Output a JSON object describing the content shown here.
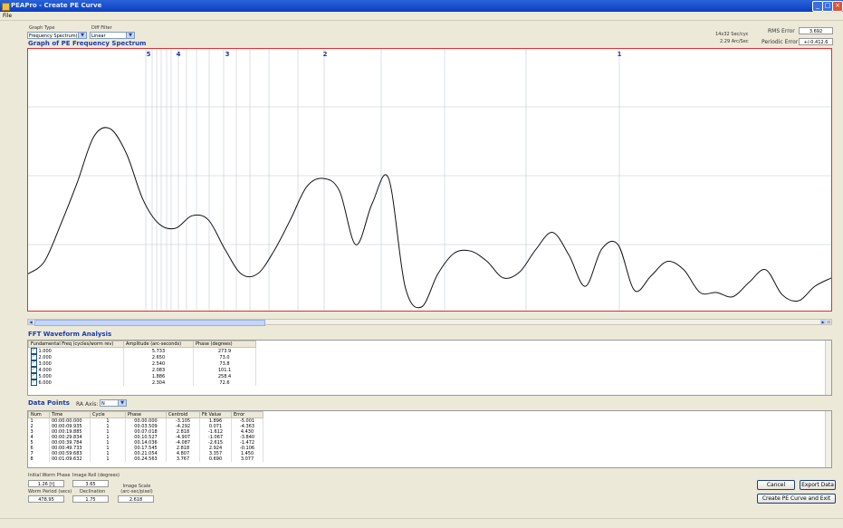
{
  "window": {
    "title": "PEAPro - Create PE Curve",
    "min": "_",
    "max": "□",
    "close": "×"
  },
  "menu": {
    "file": "File"
  },
  "graph_type": {
    "label": "Graph Type",
    "value": "Frequency Spectrum(sec"
  },
  "diff_filter": {
    "label": "Diff Filter",
    "value": "Linear"
  },
  "cycle_info": {
    "line1": "14x32 Sec/cyc",
    "line2": "2.29 Arc/Sec"
  },
  "rms_error": {
    "label": "RMS Error",
    "value": "3.692"
  },
  "periodic_error": {
    "label": "Periodic Error",
    "value": "+/-0.412.6"
  },
  "graph_title": "Graph of PE Frequency Spectrum",
  "chart_data": {
    "type": "line",
    "title": "Graph of PE Frequency Spectrum",
    "marker_labels": [
      "5",
      "4",
      "3",
      "2",
      "1"
    ],
    "curve_y": [
      0.16,
      0.22,
      0.4,
      0.6,
      0.82,
      0.86,
      0.74,
      0.52,
      0.4,
      0.38,
      0.44,
      0.42,
      0.28,
      0.16,
      0.16,
      0.27,
      0.42,
      0.58,
      0.62,
      0.56,
      0.3,
      0.5,
      0.62,
      0.1,
      0.0,
      0.16,
      0.26,
      0.27,
      0.22,
      0.14,
      0.17,
      0.28,
      0.36,
      0.25,
      0.1,
      0.28,
      0.3,
      0.08,
      0.15,
      0.22,
      0.18,
      0.07,
      0.07,
      0.05,
      0.12,
      0.18,
      0.06,
      0.03,
      0.1,
      0.14
    ]
  },
  "fft": {
    "title": "FFT Waveform Analysis",
    "columns": [
      "Fundamental Freq (cycles/worm rev)",
      "Amplitude (arc-seconds)",
      "Phase (degrees)"
    ],
    "rows": [
      {
        "checked": "✓",
        "freq": "1.000",
        "amp": "5.733",
        "phase": "273.9"
      },
      {
        "checked": "✓",
        "freq": "2.000",
        "amp": "2.650",
        "phase": "73.0"
      },
      {
        "checked": "✓",
        "freq": "3.000",
        "amp": "2.540",
        "phase": "73.8"
      },
      {
        "checked": "✓",
        "freq": "4.000",
        "amp": "2.083",
        "phase": "101.1"
      },
      {
        "checked": "✓",
        "freq": "5.000",
        "amp": "1.886",
        "phase": "258.4"
      },
      {
        "checked": "✓",
        "freq": "6.000",
        "amp": "2.304",
        "phase": "72.6"
      }
    ]
  },
  "data_points": {
    "title": "Data Points",
    "ra_axis_label": "RA Axis:",
    "ra_axis_value": "N",
    "columns": [
      "Num",
      "Time",
      "Cycle",
      "Phase",
      "Centroid",
      "Fit Value",
      "Error"
    ],
    "rows": [
      [
        "1",
        "00:00:00.000",
        "1",
        "00.00.000",
        "-3.105",
        "1.896",
        "-5.001"
      ],
      [
        "2",
        "00:00:09.935",
        "1",
        "00.03.509",
        "-4.292",
        "0.071",
        "-4.363"
      ],
      [
        "3",
        "00:00:19.885",
        "1",
        "00.07.018",
        "2.818",
        "-1.612",
        "4.430"
      ],
      [
        "4",
        "00:00:29.834",
        "1",
        "00.10.527",
        "-4.907",
        "-1.067",
        "-3.840"
      ],
      [
        "5",
        "00:00:39.784",
        "1",
        "00.14.036",
        "-4.087",
        "-2.615",
        "-1.472"
      ],
      [
        "6",
        "00:00:49.733",
        "1",
        "00.17.545",
        "2.818",
        "2.924",
        "-0.106"
      ],
      [
        "7",
        "00:00:59.683",
        "1",
        "00.21.054",
        "4.807",
        "3.357",
        "1.450"
      ],
      [
        "8",
        "00:01:09.632",
        "1",
        "00.24.563",
        "3.767",
        "0.690",
        "3.077"
      ]
    ]
  },
  "stats": {
    "initial_worm_phase": {
      "label": "Initial Worm Phase",
      "value": "1.26 [t]"
    },
    "image_roll": {
      "label": "Image Roll (degrees)",
      "value": "3.65"
    },
    "worm_period": {
      "label": "Worm Period (secs)",
      "value": "478.95"
    },
    "declination": {
      "label": "Declination",
      "value": "1.75"
    },
    "image_scale": {
      "label": "Image Scale (arc-sec/pixel)",
      "value": "2.618"
    }
  },
  "buttons": {
    "cancel": "Cancel",
    "export": "Export Data",
    "create": "Create PE Curve and Exit"
  }
}
